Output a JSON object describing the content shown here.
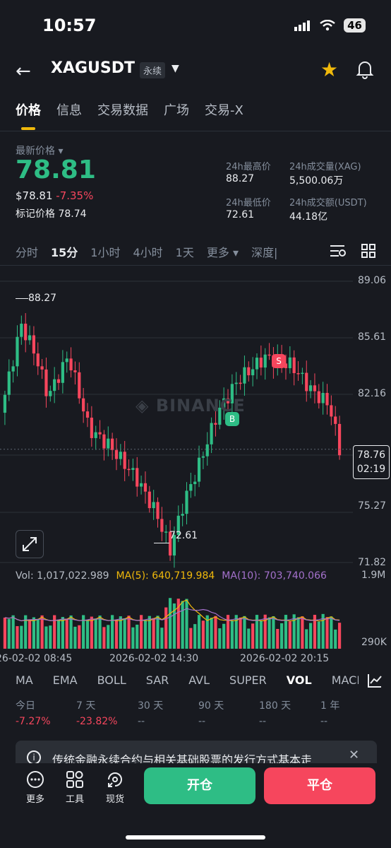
{
  "status": {
    "time": "10:57",
    "battery": "46"
  },
  "header": {
    "symbol": "XAGUSDT",
    "contract_type": "永续"
  },
  "tabs": [
    "价格",
    "信息",
    "交易数据",
    "广场",
    "交易-X"
  ],
  "price": {
    "label": "最新价格",
    "last": "78.81",
    "usd": "$78.81",
    "change": "-7.35%",
    "mark_label": "标记价格",
    "mark_value": "78.74"
  },
  "stats": {
    "high_label": "24h最高价",
    "high": "88.27",
    "vol_label": "24h成交量(XAG)",
    "vol": "5,500.06万",
    "low_label": "24h最低价",
    "low": "72.61",
    "amount_label": "24h成交额(USDT)",
    "amount": "44.18亿"
  },
  "timeframes": [
    "分时",
    "15分",
    "1小时",
    "4小时",
    "1天",
    "更多",
    "深度|"
  ],
  "chart_axis": {
    "price_ticks": [
      "89.06",
      "85.61",
      "82.16",
      "78.71",
      "75.27",
      "71.82"
    ],
    "current_price": "78.76",
    "countdown": "02:19",
    "high_marker": "88.27",
    "low_marker": "72.61",
    "watermark": "BINANCE",
    "buy_marker": "B",
    "sell_marker": "S"
  },
  "volume": {
    "label": "Vol: 1,017,022.989",
    "ma5": "MA(5): 640,719.984",
    "ma10": "MA(10): 703,740.066",
    "axis_top": "1.9M",
    "axis_bottom": "290K"
  },
  "time_axis": [
    "26-02-02 08:45",
    "2026-02-02 14:30",
    "2026-02-02 20:15"
  ],
  "indicators": [
    "MA",
    "EMA",
    "BOLL",
    "SAR",
    "AVL",
    "SUPER",
    "VOL",
    "MACD"
  ],
  "performance": {
    "labels": [
      "今日",
      "7 天",
      "30 天",
      "90 天",
      "180 天",
      "1 年"
    ],
    "values": [
      "-7.27%",
      "-23.82%",
      "--",
      "--",
      "--",
      "--"
    ]
  },
  "notice": "传统金融永续合约与相关基础股票的发行方式基本走",
  "bottom": {
    "more": "更多",
    "tools": "工具",
    "spot": "现货",
    "open": "开仓",
    "close": "平仓"
  },
  "colors": {
    "up": "#2ebd85",
    "down": "#f6465d",
    "accent": "#f0b90b",
    "ma5": "#f0b90b",
    "ma10": "#a471cc"
  }
}
